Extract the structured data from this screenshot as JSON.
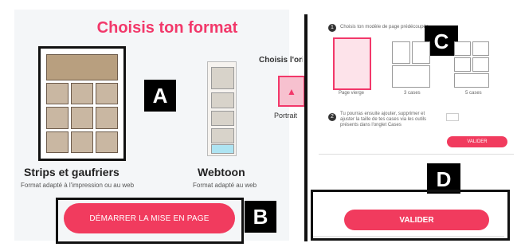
{
  "left": {
    "title": "Choisis ton format",
    "strips": {
      "title": "Strips et gaufriers",
      "subtitle": "Format adapté à l'impression ou au web"
    },
    "webtoon": {
      "title": "Webtoon",
      "subtitle": "Format adapté au web"
    },
    "orientation_title": "Choisis l'orientation",
    "portrait_label": "Portrait",
    "start_button": "DÉMARRER LA MISE EN PAGE"
  },
  "right": {
    "step1": "Choisis ton modèle de page prédécoupée",
    "models": [
      {
        "label": "Page vierge"
      },
      {
        "label": "3 cases"
      },
      {
        "label": "5 cases"
      }
    ],
    "step2": "Tu pourras ensuite ajouter, supprimer et ajuster la taille de tes cases via les outils présents dans l'onglet Cases",
    "step2_link": "Cases",
    "valider_small": "VALIDER",
    "valider_big": "VALIDER"
  },
  "labels": {
    "a": "A",
    "b": "B",
    "c": "C",
    "d": "D"
  },
  "colors": {
    "accent": "#f13b5e",
    "title": "#f2386a"
  }
}
